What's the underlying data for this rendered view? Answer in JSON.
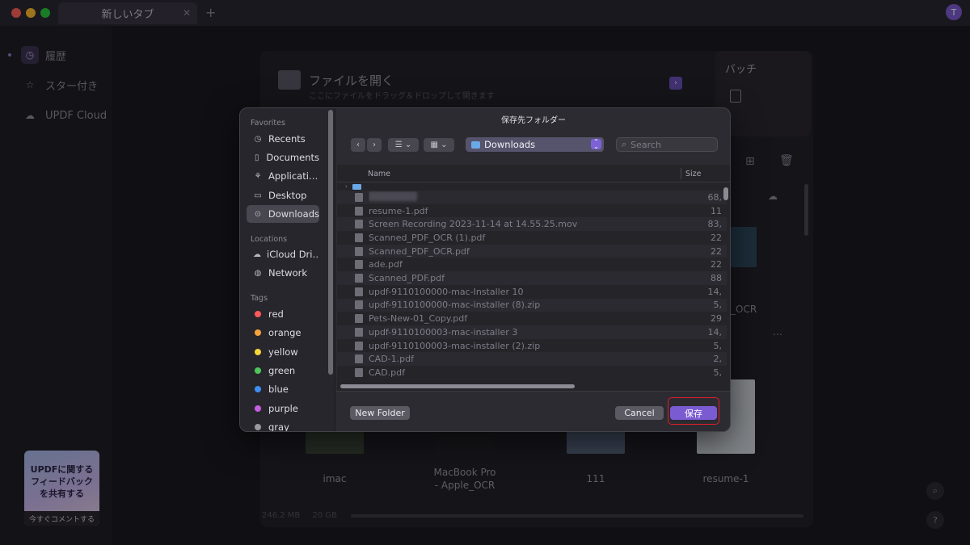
{
  "window": {
    "tab_title": "新しいタブ",
    "tab_close": "✕",
    "new_tab": "+",
    "user_initial": "T"
  },
  "app_sidebar": {
    "items": [
      {
        "label": "履歴",
        "icon": "clock-icon"
      },
      {
        "label": "スター付き",
        "icon": "star-icon"
      },
      {
        "label": "UPDF Cloud",
        "icon": "cloud-icon"
      }
    ],
    "feedback": {
      "line1": "UPDFに関する",
      "line2": "フィードバック",
      "line3": "を共有する",
      "cta": "今すぐコメントする"
    }
  },
  "main": {
    "open_file_title": "ファイルを開く",
    "open_file_sub": "ここにファイルをドラッグ＆ドロップして開きます",
    "batch_title": "バッチ",
    "thumbs": [
      {
        "label": "imac"
      },
      {
        "label": "MacBook Pro\n- Apple_OCR"
      },
      {
        "label": "111"
      },
      {
        "label": "resume-1"
      },
      {
        "label": "_OCR"
      }
    ],
    "more": "…",
    "storage_used": "246.2 MB",
    "storage_total": "20 GB"
  },
  "dialog": {
    "title": "保存先フォルダー",
    "sections": {
      "favorites": "Favorites",
      "locations": "Locations",
      "tags": "Tags"
    },
    "favorites": [
      {
        "label": "Recents",
        "icon": "clock-icon"
      },
      {
        "label": "Documents",
        "icon": "document-icon"
      },
      {
        "label": "Applicati…",
        "icon": "applications-icon"
      },
      {
        "label": "Desktop",
        "icon": "desktop-icon"
      },
      {
        "label": "Downloads",
        "icon": "download-icon"
      }
    ],
    "locations": [
      {
        "label": "iCloud Dri…",
        "icon": "cloud-icon"
      },
      {
        "label": "Network",
        "icon": "globe-icon"
      }
    ],
    "tags": [
      {
        "label": "red",
        "color": "#ff5a5a"
      },
      {
        "label": "orange",
        "color": "#f5a23a"
      },
      {
        "label": "yellow",
        "color": "#f4d53a"
      },
      {
        "label": "green",
        "color": "#4fc65a"
      },
      {
        "label": "blue",
        "color": "#3d8ff2"
      },
      {
        "label": "purple",
        "color": "#c55ee0"
      },
      {
        "label": "gray",
        "color": "#9a98a0"
      }
    ],
    "toolbar": {
      "back": "‹",
      "forward": "›",
      "list_view": "☰ ⌄",
      "grid_view": "▦ ⌄",
      "location": "Downloads",
      "search_placeholder": "Search"
    },
    "columns": {
      "name": "Name",
      "size": "Size"
    },
    "files": [
      {
        "name": "",
        "size": "68,",
        "blurred": true
      },
      {
        "name": "resume-1.pdf",
        "size": "11"
      },
      {
        "name": "Screen Recording 2023-11-14 at 14.55.25.mov",
        "size": "83,"
      },
      {
        "name": "Scanned_PDF_OCR (1).pdf",
        "size": "22"
      },
      {
        "name": "Scanned_PDF_OCR.pdf",
        "size": "22"
      },
      {
        "name": "ade.pdf",
        "size": "22"
      },
      {
        "name": "Scanned_PDF.pdf",
        "size": "88"
      },
      {
        "name": "updf-9110100000-mac-Installer 10",
        "size": "14,"
      },
      {
        "name": "updf-9110100000-mac-installer (8).zip",
        "size": "5,"
      },
      {
        "name": "Pets-New-01_Copy.pdf",
        "size": "29"
      },
      {
        "name": "updf-9110100003-mac-installer 3",
        "size": "14,"
      },
      {
        "name": "updf-9110100003-mac-installer (2).zip",
        "size": "5,"
      },
      {
        "name": "CAD-1.pdf",
        "size": "2,"
      },
      {
        "name": "CAD.pdf",
        "size": "5,"
      }
    ],
    "buttons": {
      "new_folder": "New Folder",
      "cancel": "Cancel",
      "save": "保存"
    }
  }
}
